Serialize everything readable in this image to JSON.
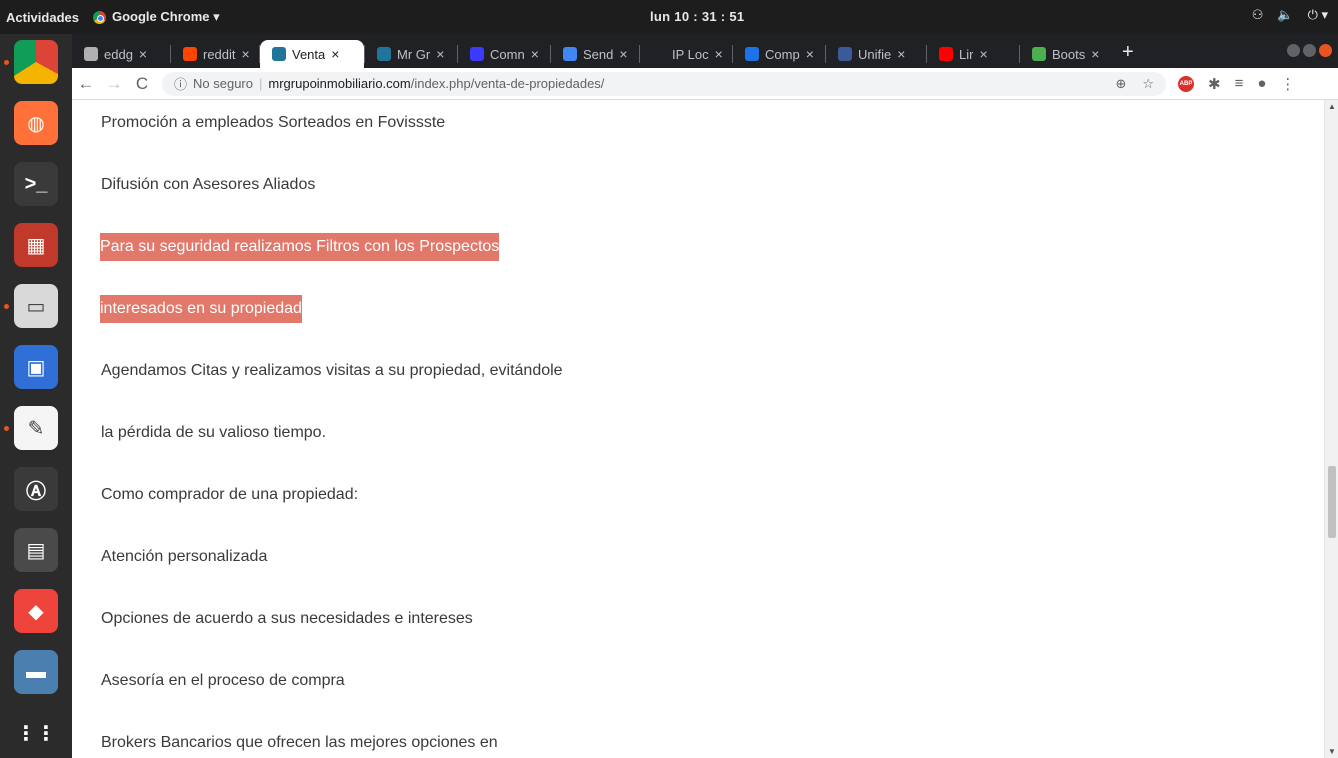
{
  "topbar": {
    "activities": "Actividades",
    "app_name": "Google Chrome ▾",
    "clock": "lun 10 : 31 : 51",
    "tray": [
      "network-icon",
      "volume-icon",
      "power-icon"
    ]
  },
  "dock": {
    "items": [
      {
        "name": "chrome",
        "color": "#ffffff",
        "running": true
      },
      {
        "name": "firefox",
        "color": "#ff7139",
        "running": false
      },
      {
        "name": "terminal",
        "color": "#3a3a3a",
        "running": false
      },
      {
        "name": "grid-app",
        "color": "#c0392b",
        "running": false
      },
      {
        "name": "files",
        "color": "#d9d9d9",
        "running": true
      },
      {
        "name": "remote-app",
        "color": "#2f6fd6",
        "running": false
      },
      {
        "name": "text-editor",
        "color": "#f5f5f5",
        "running": true
      },
      {
        "name": "software-updater",
        "color": "#3a3a3a",
        "running": false
      },
      {
        "name": "calculator",
        "color": "#4a4a4a",
        "running": false
      },
      {
        "name": "anydesk",
        "color": "#ef443b",
        "running": false
      },
      {
        "name": "drive-app",
        "color": "#4a7fb0",
        "running": false
      },
      {
        "name": "show-apps",
        "color": "#2b2b2b",
        "running": false
      }
    ]
  },
  "tabs": [
    {
      "title": "eddg",
      "color": "#b0b0b0",
      "active": false
    },
    {
      "title": "reddit",
      "color": "#ff4500",
      "active": false
    },
    {
      "title": "Venta",
      "color": "#21759b",
      "active": true
    },
    {
      "title": "Mr Gr",
      "color": "#21759b",
      "active": false
    },
    {
      "title": "Comn",
      "color": "#3b3bff",
      "active": false
    },
    {
      "title": "Send",
      "color": "#4285f4",
      "active": false
    },
    {
      "title": "IP Loc",
      "color": "#202124",
      "active": false
    },
    {
      "title": "Comp",
      "color": "#1a73e8",
      "active": false
    },
    {
      "title": "Unifie",
      "color": "#3c5a99",
      "active": false
    },
    {
      "title": "Lir",
      "color": "#ff0000",
      "active": false
    },
    {
      "title": "Boots",
      "color": "#4caf50",
      "active": false
    }
  ],
  "toolbar": {
    "not_secure": "No seguro",
    "host": "mrgrupoinmobiliario.com",
    "path": "/index.php/venta-de-propiedades/"
  },
  "content": {
    "lines": [
      {
        "text": "Promoción a empleados Sorteados en Fovissste",
        "highlight": false
      },
      {
        "text": "Difusión con Asesores Aliados",
        "highlight": false
      },
      {
        "text": "Para su seguridad realizamos Filtros con los Prospectos",
        "highlight": true
      },
      {
        "text": "interesados en su propiedad",
        "highlight": true
      },
      {
        "text": "Agendamos Citas y realizamos visitas a su propiedad, evitándole",
        "highlight": false
      },
      {
        "text": "la pérdida de su valioso tiempo.",
        "highlight": false
      },
      {
        "text": "Como comprador de una propiedad:",
        "highlight": false
      },
      {
        "text": "Atención personalizada",
        "highlight": false
      },
      {
        "text": "Opciones de acuerdo a sus necesidades e intereses",
        "highlight": false
      },
      {
        "text": "Asesoría en el proceso de compra",
        "highlight": false
      },
      {
        "text": "Brokers Bancarios que ofrecen las mejores opciones en",
        "highlight": false
      }
    ]
  }
}
